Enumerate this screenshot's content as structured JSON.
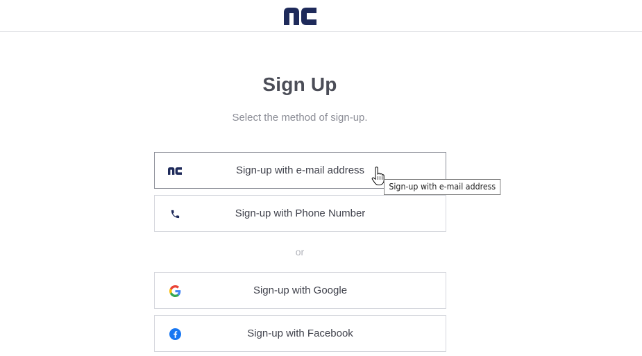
{
  "header": {
    "logo_icon": "nc-logo",
    "brand_color": "#1e2a5a"
  },
  "main": {
    "title": "Sign Up",
    "subtitle": "Select the method of sign-up.",
    "divider_text": "or"
  },
  "signup_options": [
    {
      "label": "Sign-up with e-mail address",
      "icon": "nc-logo-icon"
    },
    {
      "label": "Sign-up with Phone Number",
      "icon": "phone-icon"
    },
    {
      "label": "Sign-up with Google",
      "icon": "google-icon"
    },
    {
      "label": "Sign-up with Facebook",
      "icon": "facebook-icon"
    }
  ],
  "tooltip": {
    "text": "Sign-up with e-mail address"
  },
  "colors": {
    "text": "#40424c",
    "muted": "#8b8d96",
    "border": "#d4d6dc",
    "facebook": "#1877f2"
  }
}
